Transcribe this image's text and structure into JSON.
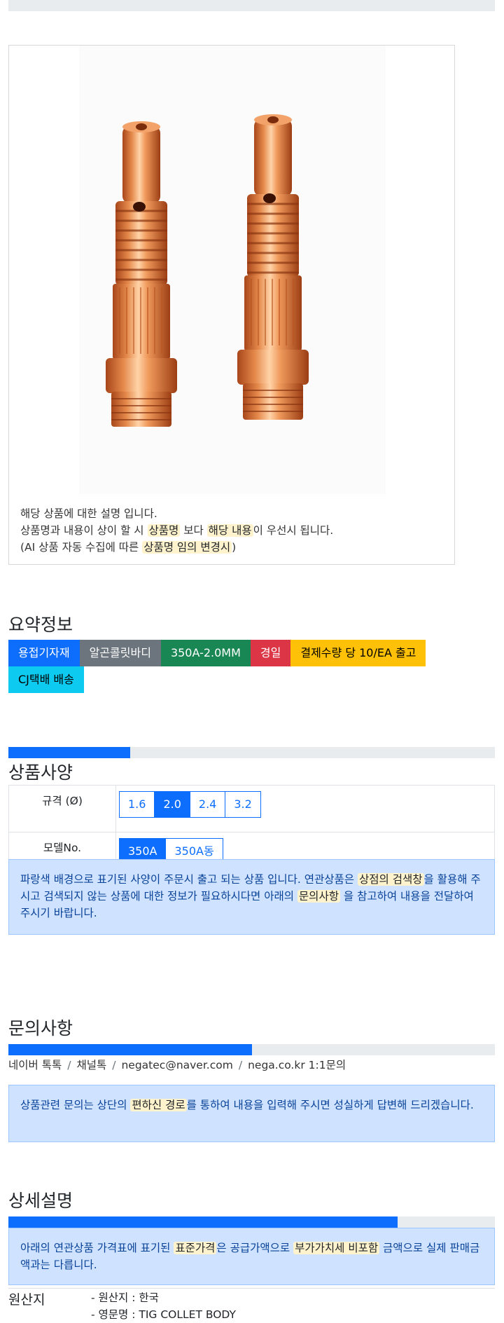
{
  "product_description": {
    "line1": "해당 상품에 대한 설명 입니다.",
    "line2_pre": "상품명과 내용이 상이 할 시 ",
    "line2_hl1": "상품명",
    "line2_mid": " 보다 ",
    "line2_hl2": "해당 내용",
    "line2_post": "이 우선시 됩니다.",
    "line3_pre": "(AI 상품 자동 수집에 따른 ",
    "line3_hl": "상품명 임의 변경시",
    "line3_post": ")"
  },
  "summary": {
    "title": "요약정보",
    "badges": [
      "용접기자재",
      "알곤콜릿바디",
      "350A-2.0MM",
      "경일",
      "결제수량 당 10/EA 출고",
      "CJ택배 배송"
    ]
  },
  "specs": {
    "title": "상품사양",
    "progress_fraction": 0.25,
    "rows": [
      {
        "label": "규격 (Ø)",
        "options": [
          "1.6",
          "2.0",
          "2.4",
          "3.2"
        ],
        "selected": "2.0"
      },
      {
        "label": "모델No.",
        "options": [
          "350A",
          "350A동"
        ],
        "selected": "350A"
      }
    ],
    "notice_pre": "파랑색 배경으로 표기된 사양이 주문시 출고 되는 상품 입니다. 연관상품은 ",
    "notice_hl1": "상점의 검색창",
    "notice_mid": "을 활용해 주시고 검색되지 않는 상품에 대한 정보가 필요하시다면 아래의 ",
    "notice_hl2": "문의사항",
    "notice_post": " 을 참고하여 내용을 전달하여 주시기 바랍니다."
  },
  "inquiry": {
    "title": "문의사항",
    "progress_fraction": 0.5,
    "channels": [
      "네이버 톡톡",
      "채널톡",
      "negatec@naver.com",
      "nega.co.kr 1:1문의"
    ],
    "separator": "/",
    "notice_pre": "상품관련 문의는 상단의 ",
    "notice_hl": "편하신 경로",
    "notice_post": "를 통하여 내용을 입력해 주시면 성실하게 답변해 드리겠습니다."
  },
  "detail": {
    "title": "상세설명",
    "progress_fraction": 0.8,
    "notice_pre": "아래의 연관상품 가격표에 표기된 ",
    "notice_hl1": "표준가격",
    "notice_mid": "은 공급가액으로 ",
    "notice_hl2": "부가가치세 비포함",
    "notice_post": " 금액으로 실제 판매금액과는 다릅니다."
  },
  "origin": {
    "label": "원산지",
    "values": [
      "- 원산지 : 한국",
      "- 영문명 : TIG COLLET BODY"
    ]
  },
  "colors": {
    "primary": "#0d6efd",
    "secondary": "#6c757d",
    "success": "#198754",
    "danger": "#dc3545",
    "warning": "#ffc107",
    "info": "#0dcaf0",
    "copper": "#e07a3a"
  }
}
